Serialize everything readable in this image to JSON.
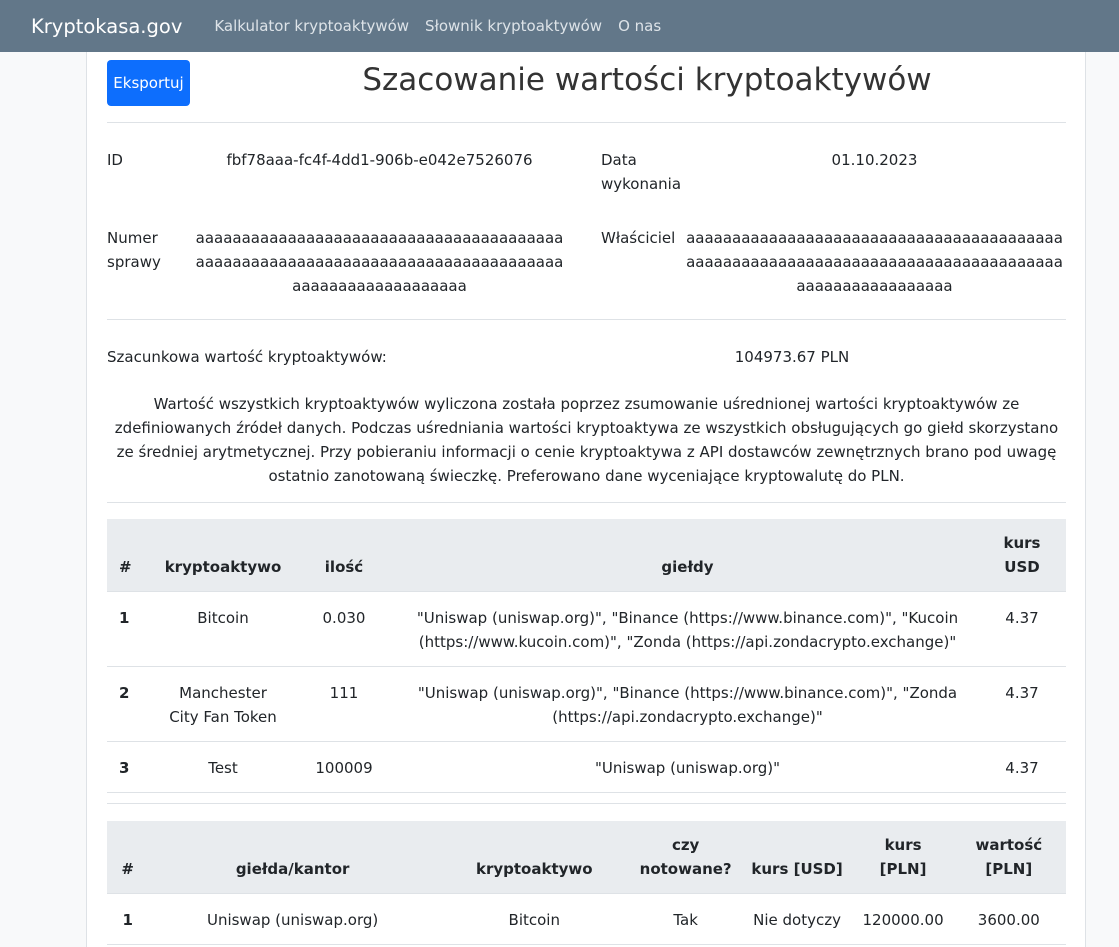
{
  "navbar": {
    "brand": "Kryptokasa.gov",
    "links": [
      "Kalkulator kryptoaktywów",
      "Słownik kryptoaktywów",
      "O nas"
    ]
  },
  "header": {
    "export_label": "Eksportuj",
    "title": "Szacowanie wartości kryptoaktywów"
  },
  "info": {
    "id_label": "ID",
    "id_value": "fbf78aaa-fc4f-4dd1-906b-e042e7526076",
    "date_label": "Data wykonania",
    "date_value": "01.10.2023",
    "case_label": "Numer sprawy",
    "case_value": "aaaaaaaaaaaaaaaaaaaaaaaaaaaaaaaaaaaaaaaaaaaaaaaaaaaaaaaaaaaaaaaaaaaaaaaaaaaaaaaaaaaaaaaaaaaaaaaaaaa",
    "owner_label": "Właściciel",
    "owner_value": "aaaaaaaaaaaaaaaaaaaaaaaaaaaaaaaaaaaaaaaaaaaaaaaaaaaaaaaaaaaaaaaaaaaaaaaaaaaaaaaaaaaaaaaaaaaaaaaaaaa"
  },
  "estimate": {
    "label": "Szacunkowa wartość kryptoaktywów:",
    "value": "104973.67 PLN",
    "description": "Wartość wszystkich kryptoaktywów wyliczona została poprzez zsumowanie uśrednionej wartości kryptoaktywów ze zdefiniowanych źródeł danych. Podczas uśredniania wartości kryptoaktywa ze wszystkich obsługujących go giełd skorzystano ze średniej arytmetycznej. Przy pobieraniu informacji o cenie kryptoaktywa z API dostawców zewnętrznych brano pod uwagę ostatnio zanotowaną świeczkę. Preferowano dane wyceniające kryptowalutę do PLN."
  },
  "assets_table": {
    "headers": [
      "#",
      "kryptoaktywo",
      "ilość",
      "giełdy",
      "kurs USD"
    ],
    "rows": [
      [
        "1",
        "Bitcoin",
        "0.030",
        "\"Uniswap (uniswap.org)\", \"Binance (https://www.binance.com)\", \"Kucoin (https://www.kucoin.com)\", \"Zonda (https://api.zondacrypto.exchange)\"",
        "4.37"
      ],
      [
        "2",
        "Manchester City Fan Token",
        "111",
        "\"Uniswap (uniswap.org)\", \"Binance (https://www.binance.com)\", \"Zonda (https://api.zondacrypto.exchange)\"",
        "4.37"
      ],
      [
        "3",
        "Test",
        "100009",
        "\"Uniswap (uniswap.org)\"",
        "4.37"
      ]
    ]
  },
  "exchange_table": {
    "headers": [
      "#",
      "giełda/kantor",
      "kryptoaktywo",
      "czy notowane?",
      "kurs [USD]",
      "kurs [PLN]",
      "wartość [PLN]"
    ],
    "rows": [
      [
        "1",
        "Uniswap (uniswap.org)",
        "Bitcoin",
        "Tak",
        "Nie dotyczy",
        "120000.00",
        "3600.00"
      ]
    ]
  }
}
